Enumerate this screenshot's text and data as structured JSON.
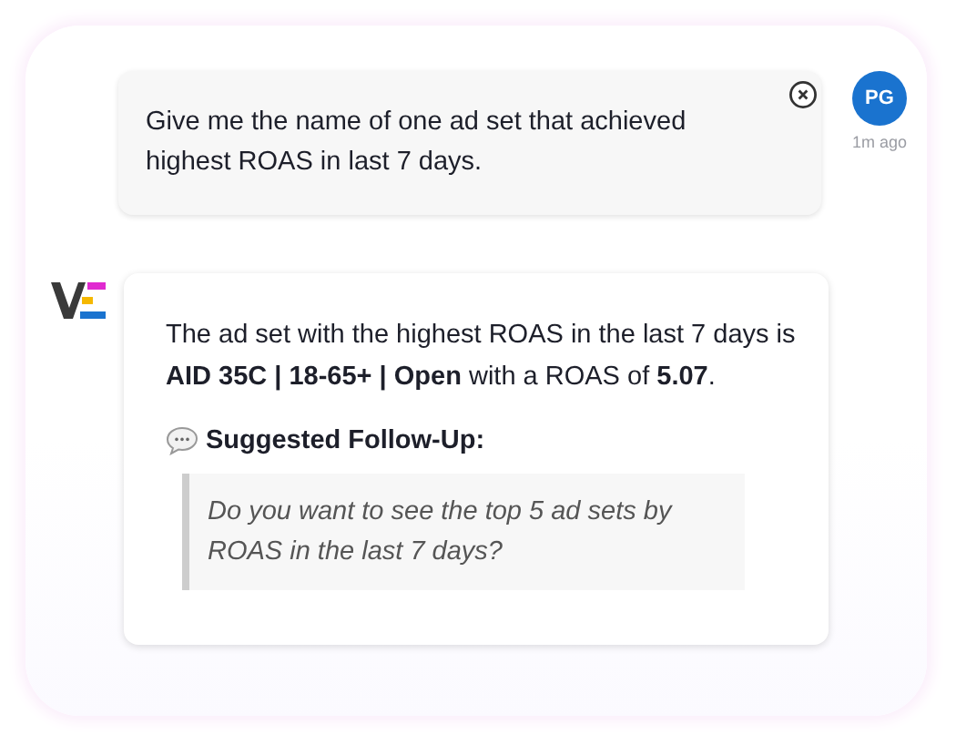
{
  "user_message": {
    "text": "Give me the name of one ad set that achieved highest ROAS in last 7 days.",
    "avatar_initials": "PG",
    "time": "1m ago"
  },
  "bot_message": {
    "answer": "The ad set with the highest ROAS in the last 7 days is **AID 35C | 18-65+ | Open** with a ROAS of **5.07**.",
    "follow_up_title": "Suggested Follow-Up:",
    "follow_up_question": "Do you want to see the top 5 ad sets by ROAS in the last 7 days?"
  }
}
